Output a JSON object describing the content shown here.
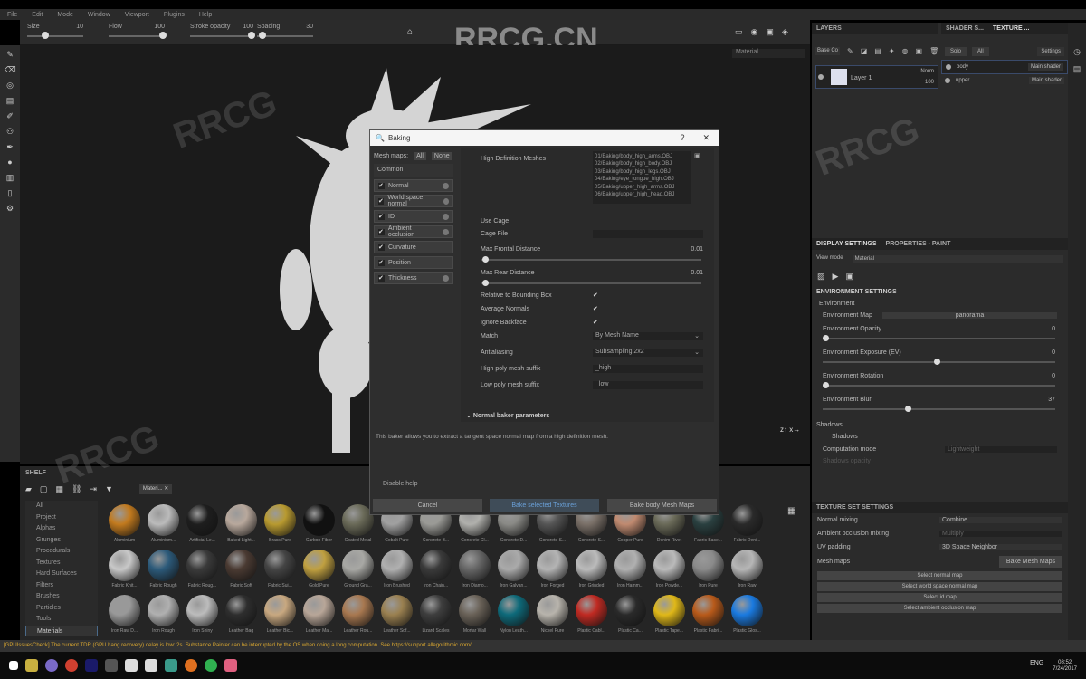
{
  "menu": [
    "File",
    "Edit",
    "Mode",
    "Window",
    "Viewport",
    "Plugins",
    "Help"
  ],
  "toolbar": {
    "size_label": "Size",
    "size_value": "10",
    "flow_label": "Flow",
    "flow_value": "100",
    "opacity_label": "Stroke opacity",
    "opacity_value": "100",
    "spacing_label": "Spacing",
    "spacing_value": "30",
    "material_select": "Material"
  },
  "watermark": "RRCG.CN",
  "dialog": {
    "title": "Baking",
    "help": "?",
    "close": "✕",
    "mesh_maps_label": "Mesh maps:",
    "all": "All",
    "none": "None",
    "common": "Common",
    "bakers": [
      "Normal",
      "World space normal",
      "ID",
      "Ambient occlusion",
      "Curvature",
      "Position",
      "Thickness"
    ],
    "high_def_label": "High Definition Meshes",
    "meshes": [
      "01/Baking/body_high_arms.OBJ",
      "02/Baking/body_high_body.OBJ",
      "03/Baking/body_high_legs.OBJ",
      "04/Baking/eye_tongue_high.OBJ",
      "05/Baking/upper_high_arms.OBJ",
      "06/Baking/upper_high_head.OBJ"
    ],
    "use_cage": "Use Cage",
    "cage_file": "Cage File",
    "max_frontal": "Max Frontal Distance",
    "max_frontal_value": "0.01",
    "max_rear": "Max Rear Distance",
    "max_rear_value": "0.01",
    "relative_bbox": "Relative to Bounding Box",
    "average_normals": "Average Normals",
    "ignore_backface": "Ignore Backface",
    "match": "Match",
    "match_value": "By Mesh Name",
    "antialiasing": "Antialiasing",
    "antialiasing_value": "Subsampling 2x2",
    "high_suffix": "High poly mesh suffix",
    "high_suffix_value": "_high",
    "low_suffix": "Low poly mesh suffix",
    "low_suffix_value": "_low",
    "normal_params": "Normal baker parameters",
    "help_text": "This baker allows you to extract a tangent space normal map from a high definition mesh.",
    "disable_help": "Disable help",
    "cancel": "Cancel",
    "bake_selected": "Bake selected Textures",
    "bake_all": "Bake body Mesh Maps",
    "frontal_fraction": 0.01,
    "rear_fraction": 0.01
  },
  "shelf": {
    "title": "SHELF",
    "filter": "Materi... ✕",
    "categories": [
      "All",
      "Project",
      "Alphas",
      "Grunges",
      "Procedurals",
      "Textures",
      "Hard Surfaces",
      "Filters",
      "Brushes",
      "Particles",
      "Tools",
      "Materials"
    ],
    "materials": [
      {
        "n": "Aluminium",
        "c": "#c27a1e"
      },
      {
        "n": "Aluminium...",
        "c": "#bbbbbb"
      },
      {
        "n": "Artificial Le...",
        "c": "#1e1e1e"
      },
      {
        "n": "Baked Light...",
        "c": "#b8a89c"
      },
      {
        "n": "Brass Pure",
        "c": "#b89a30"
      },
      {
        "n": "Carbon Fiber",
        "c": "#111111"
      },
      {
        "n": "Coated Metal",
        "c": "#6a6a58"
      },
      {
        "n": "Cobalt Pure",
        "c": "#a0a0a0"
      },
      {
        "n": "Concrete B...",
        "c": "#9a9a96"
      },
      {
        "n": "Concrete Cl...",
        "c": "#b0b0ac"
      },
      {
        "n": "Concrete D...",
        "c": "#8a8a86"
      },
      {
        "n": "Concrete S...",
        "c": "#555555"
      },
      {
        "n": "Concrete S...",
        "c": "#7a7068"
      },
      {
        "n": "Copper Pure",
        "c": "#c08a70"
      },
      {
        "n": "Denim Rivet",
        "c": "#6a6a58"
      },
      {
        "n": "Fabric Base...",
        "c": "#2a4040"
      },
      {
        "n": "Fabric Deni...",
        "c": "#2a2a2a"
      },
      {
        "n": "Fabric Knit...",
        "c": "#c8c8c8"
      },
      {
        "n": "Fabric Rough",
        "c": "#2c5a7a"
      },
      {
        "n": "Fabric Roug...",
        "c": "#3a3a3a"
      },
      {
        "n": "Fabric Soft",
        "c": "#4a3a32"
      },
      {
        "n": "Fabric Sui...",
        "c": "#444444"
      },
      {
        "n": "Gold Pure",
        "c": "#c0a040"
      },
      {
        "n": "Ground Gra...",
        "c": "#a8a8a4"
      },
      {
        "n": "Iron Brushed",
        "c": "#b0b0b0"
      },
      {
        "n": "Iron Chain...",
        "c": "#3a3a3a"
      },
      {
        "n": "Iron Diamo...",
        "c": "#666666"
      },
      {
        "n": "Iron Galvan...",
        "c": "#aaaaaa"
      },
      {
        "n": "Iron Forged",
        "c": "#b4b4b4"
      },
      {
        "n": "Iron Grinded",
        "c": "#bbbbbb"
      },
      {
        "n": "Iron Hamm...",
        "c": "#b0b0b0"
      },
      {
        "n": "Iron Powde...",
        "c": "#bababa"
      },
      {
        "n": "Iron Pure",
        "c": "#8a8a8a"
      },
      {
        "n": "Iron Raw",
        "c": "#b6b6b6"
      },
      {
        "n": "Iron Raw D...",
        "c": "#999999"
      },
      {
        "n": "Iron Rough",
        "c": "#b0b0b0"
      },
      {
        "n": "Iron Shiny",
        "c": "#bcbcbc"
      },
      {
        "n": "Leather Bag",
        "c": "#2e2e2e"
      },
      {
        "n": "Leather Bic...",
        "c": "#c8a880"
      },
      {
        "n": "Leather Ma...",
        "c": "#b8a698"
      },
      {
        "n": "Leather Rou...",
        "c": "#a87850"
      },
      {
        "n": "Leather Sof...",
        "c": "#9a8050"
      },
      {
        "n": "Lizard Scales",
        "c": "#3e3e3e"
      },
      {
        "n": "Mortar Wall",
        "c": "#6a6258"
      },
      {
        "n": "Nylon Leath...",
        "c": "#0e6a7a"
      },
      {
        "n": "Nickel Pure",
        "c": "#b8b4ac"
      },
      {
        "n": "Plastic Cabl...",
        "c": "#c02a22"
      },
      {
        "n": "Plastic Ca...",
        "c": "#2a2a2a"
      },
      {
        "n": "Plastic Tape...",
        "c": "#e0b818"
      },
      {
        "n": "Plastic Fabri...",
        "c": "#b85a1a"
      },
      {
        "n": "Plastic Glos...",
        "c": "#1a7ae0"
      }
    ]
  },
  "layers": {
    "title": "LAYERS",
    "blend": "Base Co",
    "layer_name": "Layer 1",
    "layer_blend": "Norm",
    "layer_opacity": "100"
  },
  "texset": {
    "tab1": "SHADER S...",
    "tab2": "TEXTURE ...",
    "solo": "Solo",
    "all": "All",
    "settings": "Settings",
    "sets": [
      {
        "name": "body",
        "shader": "Main shader"
      },
      {
        "name": "upper",
        "shader": "Main shader"
      }
    ]
  },
  "display": {
    "tab1": "DISPLAY SETTINGS",
    "tab2": "PROPERTIES - PAINT",
    "view_mode_label": "View mode",
    "view_mode": "Material",
    "env_title": "ENVIRONMENT SETTINGS",
    "env_group": "Environment",
    "env_map": "Environment Map",
    "env_map_value": "panorama",
    "sliders": [
      {
        "label": "Environment Opacity",
        "value": "0",
        "fraction": 0
      },
      {
        "label": "Environment Exposure (EV)",
        "value": "0",
        "fraction": 0.5
      },
      {
        "label": "Environment Rotation",
        "value": "0",
        "fraction": 0
      },
      {
        "label": "Environment Blur",
        "value": "37",
        "fraction": 0.37
      }
    ],
    "shadows": "Shadows",
    "shadows_cb": "Shadows",
    "computation": "Computation mode",
    "computation_value": "Lightweight",
    "shadows_opacity": "Shadows opacity"
  },
  "tss": {
    "title": "TEXTURE SET SETTINGS",
    "normal_mixing": "Normal mixing",
    "normal_mixing_value": "Combine",
    "ao_mixing": "Ambient occlusion mixing",
    "ao_mixing_value": "Multiply",
    "uv_padding": "UV padding",
    "uv_padding_value": "3D Space Neighbor",
    "mesh_maps": "Mesh maps",
    "bake": "Bake Mesh Maps",
    "slots": [
      "Select normal map",
      "Select world space normal map",
      "Select id map",
      "Select ambient occlusion map"
    ]
  },
  "status": "[GPUIssuesCheck] The current TDR (GPU hang recovery) delay is low: 2s. Substance Painter can be interrupted by the OS when doing a long computation. See https://support.allegorithmic.com/...",
  "tray": {
    "lang": "ENG",
    "time": "08:52",
    "date": "7/24/2017"
  }
}
